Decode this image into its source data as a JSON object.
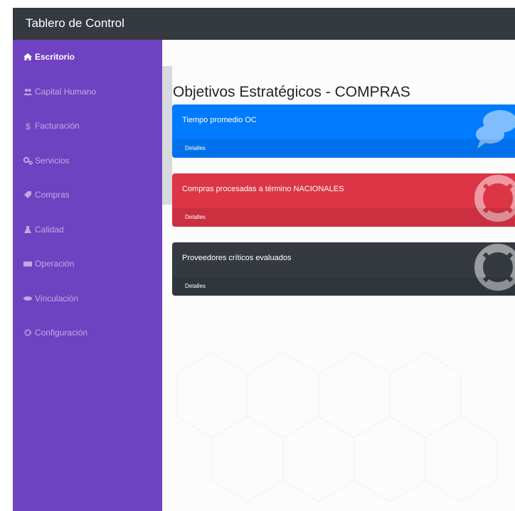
{
  "header": {
    "title": "Tablero de Control"
  },
  "sidebar": {
    "items": [
      {
        "label": "Escritorio",
        "icon": "home-icon",
        "active": true
      },
      {
        "label": "Capital Humano",
        "icon": "users-icon"
      },
      {
        "label": "Facturación",
        "icon": "dollar-icon"
      },
      {
        "label": "Servicios",
        "icon": "cogs-icon"
      },
      {
        "label": "Compras",
        "icon": "tag-icon"
      },
      {
        "label": "Calidad",
        "icon": "flask-icon"
      },
      {
        "label": "Operación",
        "icon": "money-icon"
      },
      {
        "label": "Vinculación",
        "icon": "handshake-icon"
      },
      {
        "label": "Configuración",
        "icon": "gear-icon"
      }
    ]
  },
  "main": {
    "title": "Objetivos Estratégicos - COMPRAS",
    "cards": [
      {
        "title": "Tiempo promedio OC",
        "link": "Detalles",
        "color": "#007bff",
        "icon": "comments-icon"
      },
      {
        "title": "Compras procesadas a término NACIONALES",
        "link": "Detalles",
        "color": "#dc3545",
        "icon": "life-ring-icon"
      },
      {
        "title": "Proveedores críticos evaluados",
        "link": "Detalles",
        "color": "#343a40",
        "icon": "life-ring-icon"
      }
    ]
  },
  "colors": {
    "sidebar": "#6f42c1",
    "topbar": "#343a40",
    "primary": "#007bff",
    "danger": "#dc3545",
    "dark": "#343a40"
  }
}
